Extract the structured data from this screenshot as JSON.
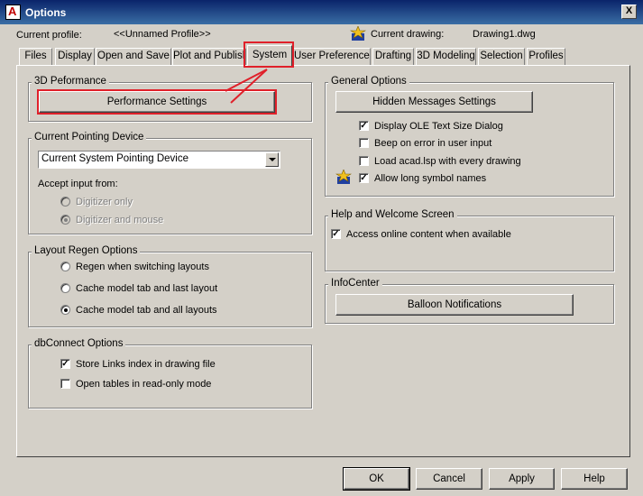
{
  "window": {
    "title": "Options",
    "close_label": "X"
  },
  "header": {
    "current_profile_label": "Current profile:",
    "current_profile_value": "<<Unnamed Profile>>",
    "current_drawing_label": "Current drawing:",
    "current_drawing_value": "Drawing1.dwg"
  },
  "tabs": [
    {
      "label": "Files"
    },
    {
      "label": "Display"
    },
    {
      "label": "Open and Save"
    },
    {
      "label": "Plot and Publish"
    },
    {
      "label": "System",
      "active": true
    },
    {
      "label": "User Preferences"
    },
    {
      "label": "Drafting"
    },
    {
      "label": "3D Modeling"
    },
    {
      "label": "Selection"
    },
    {
      "label": "Profiles"
    }
  ],
  "perf": {
    "title": "3D Peformance",
    "button": "Performance Settings"
  },
  "pointing": {
    "title": "Current Pointing Device",
    "selected": "Current System Pointing Device",
    "accept_label": "Accept input from:",
    "options": [
      "Digitizer only",
      "Digitizer and mouse"
    ]
  },
  "regen": {
    "title": "Layout Regen Options",
    "options": [
      "Regen when switching layouts",
      "Cache model tab and last layout",
      "Cache model tab and all layouts"
    ]
  },
  "dbconnect": {
    "title": "dbConnect Options",
    "options": [
      "Store Links index in drawing file",
      "Open tables in read-only mode"
    ]
  },
  "general": {
    "title": "General Options",
    "button": "Hidden Messages Settings",
    "options": [
      "Display OLE Text Size Dialog",
      "Beep on error in user input",
      "Load acad.lsp with every drawing",
      "Allow long symbol names"
    ]
  },
  "help": {
    "title": "Help and Welcome Screen",
    "option": "Access online content when available"
  },
  "infocenter": {
    "title": "InfoCenter",
    "button": "Balloon Notifications"
  },
  "footer": {
    "ok": "OK",
    "cancel": "Cancel",
    "apply": "Apply",
    "help": "Help"
  },
  "check_mark": "✓",
  "colors": {
    "annotation_red": "#e0202a",
    "titlebar": "#0a246a",
    "face": "#d4d0c8"
  }
}
